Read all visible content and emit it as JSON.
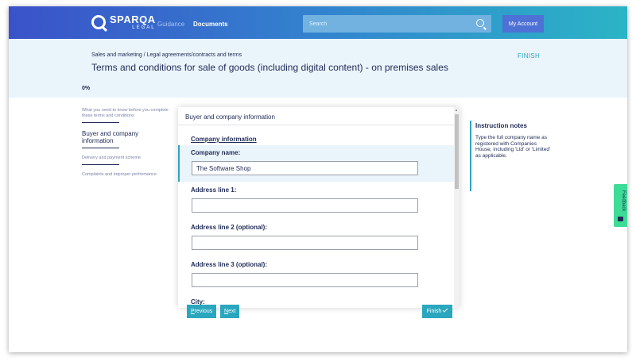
{
  "nav": {
    "brand": "SPARQA",
    "brand_sub": "LEGAL",
    "guidance": "Guidance",
    "documents": "Documents",
    "search_placeholder": "Search",
    "account": "My Account"
  },
  "header": {
    "breadcrumb": "Sales and marketing / Legal agreements/contracts and terms",
    "title": "Terms and conditions for sale of goods (including digital content) - on premises sales",
    "finish": "FINISH",
    "progress": "0%"
  },
  "steps": [
    {
      "label": "What you need to know before you complete these terms and conditions"
    },
    {
      "label": "Buyer and company information"
    },
    {
      "label": "Delivery and payment scheme"
    },
    {
      "label": "Complaints and improper performance"
    }
  ],
  "form": {
    "panel_title": "Buyer and company information",
    "section_title": "Company information",
    "fields": [
      {
        "label": "Company name:",
        "value": "The Software Shop"
      },
      {
        "label": "Address line 1:",
        "value": ""
      },
      {
        "label": "Address line 2 (optional):",
        "value": ""
      },
      {
        "label": "Address line 3 (optional):",
        "value": ""
      },
      {
        "label": "City:",
        "value": ""
      }
    ]
  },
  "buttons": {
    "previous_first": "P",
    "previous_rest": "revious",
    "next_first": "N",
    "next_rest": "ext",
    "finish": "Finish"
  },
  "notes": {
    "title": "Instruction notes",
    "text": "Type the full company name as registered with Companies House, including 'Ltd' or 'Limited' as applicable."
  },
  "feedback": {
    "label": "Feedback"
  },
  "colors": {
    "accent": "#2aa7be",
    "navy": "#1f2a55",
    "header_bg": "#eaf4fb"
  }
}
